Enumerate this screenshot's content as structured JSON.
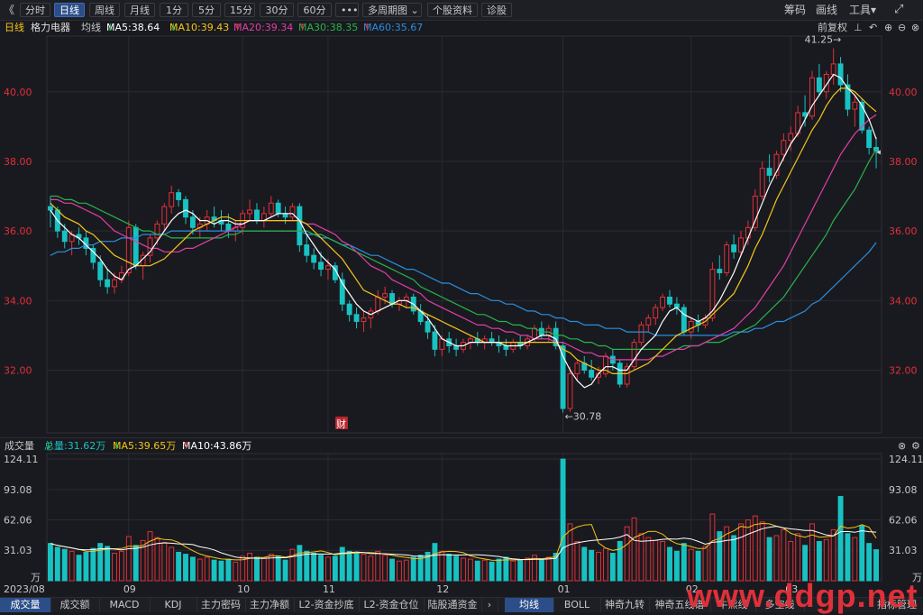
{
  "toolbar": {
    "back": "《",
    "periods": [
      "分时",
      "日线",
      "周线",
      "月线",
      "1分",
      "5分",
      "15分",
      "30分",
      "60分",
      "•••",
      "多周期图",
      "个股资料",
      "诊股"
    ],
    "multi_arrow": "⌄",
    "right_items": [
      "筹码",
      "画线",
      "工具"
    ],
    "tools_arrow": "▾",
    "fullscreen": "⤢"
  },
  "ma": {
    "period": "日线",
    "name": "格力电器",
    "line_label": "均线",
    "ma5": "MA5:38.64",
    "ma5_arrow": "↓",
    "ma10": "MA10:39.43",
    "ma10_arrow": "↓",
    "ma20": "MA20:39.34",
    "ma20_arrow": "↑",
    "ma30": "MA30:38.35",
    "ma30_arrow": "↑",
    "ma60": "MA60:35.67",
    "ma60_arrow": "↑",
    "adjust": "前复权",
    "colors": {
      "ma5": "#ffffff",
      "ma10": "#f5c518",
      "ma20": "#e03ea8",
      "ma30": "#28b34b",
      "ma60": "#2a8ee0"
    }
  },
  "vol": {
    "label": "成交量",
    "total": "总量:31.62万",
    "total_arrow": "↓",
    "ma5": "MA5:39.65万",
    "ma5_arrow": "↓",
    "ma10": "MA10:43.86万",
    "ma10_arrow": "↑"
  },
  "chart_labels": {
    "price_ticks": [
      "40.00",
      "38.00",
      "36.00",
      "34.00",
      "32.00"
    ],
    "vol_ticks": [
      "124.11",
      "93.08",
      "62.06",
      "31.03",
      "万"
    ],
    "x_ticks": [
      "2023/08",
      "09",
      "10",
      "11",
      "12",
      "01",
      "02",
      "03"
    ],
    "high_label": "41.25→",
    "low_label": "←30.78",
    "cai_marker": "财",
    "last_marker": "◂"
  },
  "bottom_tabs": [
    "成交量",
    "成交额",
    "MACD",
    "KDJ",
    "主力密码",
    "主力净额",
    "L2-资金抄底",
    "L2-资金仓位",
    "陆股通资金",
    "›",
    "均线",
    "BOLL",
    "神奇九转",
    "神奇五线谱",
    "牛熊线",
    "多空线",
    "指标管理"
  ],
  "watermark": "www.ddgp.net",
  "chart_data": {
    "type": "candlestick",
    "title": "格力电器 日线",
    "price_ylim": [
      30.2,
      41.6
    ],
    "volume_unit": "万",
    "volume_ylim": [
      0,
      124.11
    ],
    "candles": [
      [
        36.7,
        37.0,
        36.1,
        36.6,
        38
      ],
      [
        36.6,
        36.7,
        35.8,
        36.0,
        34
      ],
      [
        36.0,
        36.2,
        35.5,
        35.7,
        32
      ],
      [
        35.7,
        36.0,
        35.3,
        35.9,
        30
      ],
      [
        35.9,
        36.1,
        35.6,
        35.8,
        26
      ],
      [
        35.8,
        36.0,
        35.3,
        35.5,
        29
      ],
      [
        35.5,
        35.6,
        34.9,
        35.1,
        33
      ],
      [
        35.1,
        35.3,
        34.4,
        34.6,
        38
      ],
      [
        34.6,
        34.9,
        34.2,
        34.4,
        35
      ],
      [
        34.4,
        34.8,
        34.2,
        34.6,
        28
      ],
      [
        34.6,
        35.0,
        34.5,
        34.8,
        30
      ],
      [
        34.8,
        36.3,
        34.7,
        36.1,
        45
      ],
      [
        36.1,
        36.2,
        34.9,
        35.0,
        36
      ],
      [
        35.0,
        35.4,
        34.6,
        35.3,
        41
      ],
      [
        35.3,
        35.9,
        35.1,
        35.8,
        50
      ],
      [
        35.8,
        36.3,
        35.6,
        36.2,
        44
      ],
      [
        36.2,
        36.8,
        36.0,
        36.7,
        39
      ],
      [
        36.7,
        37.3,
        36.5,
        37.1,
        34
      ],
      [
        37.1,
        37.2,
        36.7,
        36.9,
        29
      ],
      [
        36.9,
        37.0,
        36.2,
        36.4,
        27
      ],
      [
        36.4,
        36.6,
        35.9,
        36.1,
        24
      ],
      [
        36.1,
        36.4,
        35.8,
        36.2,
        22
      ],
      [
        36.2,
        36.6,
        36.0,
        36.4,
        24
      ],
      [
        36.4,
        36.7,
        36.1,
        36.3,
        21
      ],
      [
        36.3,
        36.6,
        36.0,
        36.2,
        20
      ],
      [
        36.2,
        36.5,
        35.8,
        36.0,
        22
      ],
      [
        36.0,
        36.3,
        35.7,
        36.1,
        19
      ],
      [
        36.1,
        36.6,
        35.9,
        36.5,
        25
      ],
      [
        36.5,
        36.9,
        36.3,
        36.6,
        28
      ],
      [
        36.6,
        36.8,
        36.2,
        36.3,
        24
      ],
      [
        36.3,
        36.7,
        36.1,
        36.5,
        23
      ],
      [
        36.5,
        37.0,
        36.4,
        36.8,
        27
      ],
      [
        36.8,
        36.9,
        36.4,
        36.5,
        25
      ],
      [
        36.5,
        36.7,
        36.2,
        36.4,
        21
      ],
      [
        36.4,
        36.8,
        36.3,
        36.7,
        32
      ],
      [
        36.7,
        36.8,
        35.4,
        35.6,
        36
      ],
      [
        35.6,
        35.9,
        35.1,
        35.3,
        30
      ],
      [
        35.3,
        35.5,
        34.9,
        35.1,
        28
      ],
      [
        35.1,
        35.4,
        34.7,
        34.9,
        26
      ],
      [
        34.9,
        35.2,
        34.6,
        35.0,
        24
      ],
      [
        35.0,
        35.1,
        34.5,
        34.6,
        25
      ],
      [
        34.6,
        34.8,
        33.7,
        33.9,
        34
      ],
      [
        33.9,
        34.0,
        33.4,
        33.6,
        30
      ],
      [
        33.6,
        33.8,
        33.2,
        33.4,
        28
      ],
      [
        33.4,
        33.7,
        33.1,
        33.5,
        27
      ],
      [
        33.5,
        33.8,
        33.2,
        33.7,
        25
      ],
      [
        33.7,
        34.3,
        33.6,
        34.1,
        30
      ],
      [
        34.1,
        34.4,
        33.9,
        34.2,
        26
      ],
      [
        34.2,
        34.3,
        33.8,
        33.9,
        22
      ],
      [
        33.9,
        34.1,
        33.7,
        34.0,
        20
      ],
      [
        34.0,
        34.2,
        33.8,
        34.1,
        21
      ],
      [
        34.1,
        34.2,
        33.6,
        33.7,
        24
      ],
      [
        33.7,
        33.9,
        33.3,
        33.4,
        26
      ],
      [
        33.4,
        33.6,
        32.9,
        33.1,
        29
      ],
      [
        33.1,
        33.3,
        32.4,
        32.6,
        38
      ],
      [
        32.6,
        33.0,
        32.4,
        32.9,
        30
      ],
      [
        32.9,
        33.1,
        32.5,
        32.7,
        27
      ],
      [
        32.7,
        32.9,
        32.4,
        32.6,
        25
      ],
      [
        32.6,
        32.9,
        32.5,
        32.8,
        23
      ],
      [
        32.8,
        33.0,
        32.6,
        32.9,
        22
      ],
      [
        32.9,
        33.1,
        32.7,
        32.8,
        20
      ],
      [
        32.8,
        33.0,
        32.6,
        32.9,
        21
      ],
      [
        32.9,
        33.1,
        32.7,
        32.8,
        19
      ],
      [
        32.8,
        33.0,
        32.5,
        32.7,
        22
      ],
      [
        32.7,
        32.9,
        32.4,
        32.6,
        24
      ],
      [
        32.6,
        32.9,
        32.5,
        32.8,
        20
      ],
      [
        32.8,
        33.0,
        32.6,
        32.7,
        21
      ],
      [
        32.7,
        33.0,
        32.6,
        32.9,
        23
      ],
      [
        32.9,
        33.3,
        32.8,
        33.2,
        26
      ],
      [
        33.2,
        33.4,
        32.9,
        33.0,
        22
      ],
      [
        33.0,
        33.3,
        32.8,
        33.2,
        24
      ],
      [
        33.2,
        33.4,
        32.6,
        32.7,
        28
      ],
      [
        32.7,
        32.8,
        30.78,
        30.9,
        124
      ],
      [
        30.9,
        32.1,
        30.8,
        31.9,
        58
      ],
      [
        31.9,
        32.3,
        31.7,
        32.2,
        40
      ],
      [
        32.2,
        32.4,
        31.9,
        32.0,
        34
      ],
      [
        32.0,
        32.3,
        31.7,
        31.8,
        31
      ],
      [
        31.8,
        32.1,
        31.6,
        31.9,
        29
      ],
      [
        31.9,
        32.5,
        31.8,
        32.4,
        33
      ],
      [
        32.4,
        32.6,
        32.0,
        32.2,
        28
      ],
      [
        32.2,
        32.3,
        31.5,
        31.6,
        40
      ],
      [
        31.6,
        32.2,
        31.5,
        32.1,
        55
      ],
      [
        32.1,
        32.9,
        32.0,
        32.8,
        64
      ],
      [
        32.8,
        33.4,
        32.7,
        33.3,
        48
      ],
      [
        33.3,
        33.6,
        33.1,
        33.5,
        44
      ],
      [
        33.5,
        33.9,
        33.3,
        33.8,
        41
      ],
      [
        33.8,
        34.2,
        33.7,
        34.1,
        40
      ],
      [
        34.1,
        34.3,
        33.8,
        33.9,
        34
      ],
      [
        33.9,
        34.1,
        33.6,
        33.8,
        30
      ],
      [
        33.8,
        33.9,
        33.0,
        33.1,
        38
      ],
      [
        33.1,
        33.5,
        32.9,
        33.4,
        32
      ],
      [
        33.4,
        33.6,
        33.1,
        33.3,
        30
      ],
      [
        33.3,
        33.6,
        33.2,
        33.5,
        35
      ],
      [
        33.5,
        35.1,
        33.4,
        34.9,
        68
      ],
      [
        34.9,
        35.3,
        34.6,
        34.8,
        50
      ],
      [
        34.8,
        35.7,
        34.7,
        35.6,
        55
      ],
      [
        35.6,
        35.9,
        35.2,
        35.4,
        46
      ],
      [
        35.4,
        36.0,
        35.3,
        35.8,
        58
      ],
      [
        35.8,
        36.3,
        35.6,
        36.1,
        62
      ],
      [
        36.1,
        37.2,
        36.0,
        37.0,
        66
      ],
      [
        37.0,
        38.0,
        36.9,
        37.8,
        60
      ],
      [
        37.8,
        38.2,
        37.4,
        37.6,
        44
      ],
      [
        37.6,
        38.3,
        37.5,
        38.2,
        46
      ],
      [
        38.2,
        38.8,
        38.0,
        38.6,
        52
      ],
      [
        38.6,
        39.0,
        38.3,
        38.8,
        40
      ],
      [
        38.8,
        39.6,
        38.7,
        39.4,
        48
      ],
      [
        39.4,
        39.9,
        39.0,
        39.3,
        36
      ],
      [
        39.3,
        40.6,
        39.2,
        40.4,
        58
      ],
      [
        40.4,
        40.8,
        39.9,
        40.0,
        40
      ],
      [
        40.0,
        40.6,
        39.8,
        40.5,
        42
      ],
      [
        40.5,
        41.25,
        40.2,
        40.8,
        52
      ],
      [
        40.8,
        41.0,
        40.0,
        40.2,
        86
      ],
      [
        40.2,
        40.5,
        39.3,
        39.5,
        48
      ],
      [
        39.5,
        39.9,
        39.0,
        39.7,
        44
      ],
      [
        39.7,
        39.8,
        38.8,
        38.9,
        56
      ],
      [
        38.9,
        39.0,
        38.2,
        38.4,
        38
      ],
      [
        38.4,
        38.7,
        37.8,
        38.3,
        31.62
      ]
    ],
    "ma5": [
      36.6,
      36.3,
      36.1,
      35.9,
      35.8,
      35.6,
      35.4,
      35.2,
      34.9,
      34.7,
      34.6,
      34.9,
      35.0,
      35.2,
      35.4,
      35.7,
      36.0,
      36.3,
      36.5,
      36.6,
      36.5,
      36.3,
      36.3,
      36.2,
      36.3,
      36.3,
      36.2,
      36.2,
      36.3,
      36.3,
      36.3,
      36.4,
      36.5,
      36.5,
      36.5,
      36.3,
      35.9,
      35.6,
      35.3,
      35.1,
      34.9,
      34.5,
      34.2,
      33.9,
      33.7,
      33.6,
      33.7,
      33.8,
      33.9,
      34.0,
      34.0,
      33.9,
      33.7,
      33.5,
      33.2,
      32.9,
      32.8,
      32.7,
      32.7,
      32.8,
      32.8,
      32.8,
      32.8,
      32.8,
      32.7,
      32.7,
      32.7,
      32.8,
      32.9,
      33.0,
      33.0,
      32.9,
      32.4,
      32.0,
      31.7,
      31.5,
      31.6,
      31.9,
      32.1,
      32.1,
      32.0,
      32.0,
      32.3,
      32.6,
      32.8,
      33.0,
      33.4,
      33.7,
      33.8,
      33.6,
      33.5,
      33.4,
      33.5,
      33.7,
      34.0,
      34.4,
      34.8,
      35.3,
      35.8,
      36.3,
      36.8,
      37.3,
      37.7,
      38.1,
      38.5,
      38.8,
      39.2,
      39.6,
      39.9,
      40.2,
      40.5,
      40.4,
      40.1,
      39.9,
      39.6,
      39.2,
      38.64
    ],
    "ma10": [
      36.8,
      36.6,
      36.4,
      36.3,
      36.2,
      36.0,
      35.9,
      35.7,
      35.5,
      35.3,
      35.2,
      35.1,
      35.0,
      35.0,
      35.0,
      35.1,
      35.2,
      35.4,
      35.6,
      35.8,
      36.0,
      36.1,
      36.2,
      36.3,
      36.4,
      36.4,
      36.3,
      36.3,
      36.3,
      36.3,
      36.3,
      36.3,
      36.3,
      36.3,
      36.3,
      36.3,
      36.2,
      36.0,
      35.8,
      35.6,
      35.4,
      35.2,
      34.9,
      34.6,
      34.3,
      34.2,
      34.1,
      34.0,
      33.9,
      33.9,
      33.8,
      33.8,
      33.7,
      33.6,
      33.5,
      33.4,
      33.3,
      33.2,
      33.1,
      33.0,
      32.9,
      32.8,
      32.8,
      32.8,
      32.8,
      32.8,
      32.8,
      32.8,
      32.8,
      32.8,
      32.8,
      32.8,
      32.6,
      32.5,
      32.3,
      32.2,
      32.1,
      32.0,
      32.0,
      31.9,
      31.9,
      31.9,
      32.0,
      32.1,
      32.2,
      32.4,
      32.6,
      32.8,
      33.0,
      33.1,
      33.2,
      33.3,
      33.4,
      33.6,
      33.8,
      34.0,
      34.2,
      34.6,
      35.0,
      35.5,
      35.9,
      36.4,
      36.9,
      37.3,
      37.7,
      38.1,
      38.5,
      38.9,
      39.2,
      39.6,
      39.9,
      40.1,
      40.1,
      40.0,
      39.8,
      39.6,
      39.43
    ],
    "ma20": [
      36.9,
      36.9,
      36.8,
      36.8,
      36.7,
      36.6,
      36.5,
      36.4,
      36.2,
      36.0,
      35.9,
      35.8,
      35.7,
      35.6,
      35.5,
      35.5,
      35.4,
      35.4,
      35.4,
      35.5,
      35.5,
      35.6,
      35.7,
      35.8,
      35.9,
      36.0,
      36.1,
      36.2,
      36.3,
      36.3,
      36.3,
      36.3,
      36.3,
      36.3,
      36.3,
      36.3,
      36.2,
      36.2,
      36.1,
      36.0,
      35.9,
      35.7,
      35.6,
      35.4,
      35.2,
      35.0,
      34.9,
      34.8,
      34.6,
      34.5,
      34.4,
      34.3,
      34.2,
      34.0,
      33.9,
      33.8,
      33.7,
      33.6,
      33.5,
      33.4,
      33.3,
      33.3,
      33.2,
      33.2,
      33.1,
      33.1,
      33.0,
      33.0,
      32.9,
      32.9,
      32.9,
      32.8,
      32.8,
      32.7,
      32.6,
      32.5,
      32.5,
      32.4,
      32.4,
      32.3,
      32.3,
      32.3,
      32.3,
      32.3,
      32.3,
      32.4,
      32.4,
      32.5,
      32.6,
      32.6,
      32.7,
      32.7,
      32.8,
      32.9,
      33.0,
      33.1,
      33.2,
      33.4,
      33.6,
      33.8,
      34.1,
      34.4,
      34.7,
      35.0,
      35.4,
      35.8,
      36.2,
      36.6,
      37.0,
      37.4,
      37.8,
      38.2,
      38.5,
      38.8,
      39.0,
      39.2,
      39.34
    ],
    "ma30": [
      37.0,
      37.0,
      36.9,
      36.9,
      36.8,
      36.8,
      36.7,
      36.6,
      36.5,
      36.4,
      36.3,
      36.2,
      36.1,
      36.0,
      36.0,
      35.9,
      35.9,
      35.8,
      35.8,
      35.8,
      35.8,
      35.8,
      35.8,
      35.8,
      35.8,
      35.9,
      35.9,
      36.0,
      36.0,
      36.0,
      36.0,
      36.0,
      36.0,
      36.0,
      36.0,
      36.0,
      36.0,
      35.9,
      35.9,
      35.8,
      35.7,
      35.6,
      35.5,
      35.4,
      35.3,
      35.2,
      35.1,
      35.0,
      34.9,
      34.8,
      34.7,
      34.6,
      34.4,
      34.3,
      34.2,
      34.1,
      34.0,
      33.9,
      33.8,
      33.7,
      33.6,
      33.6,
      33.5,
      33.4,
      33.4,
      33.3,
      33.3,
      33.2,
      33.2,
      33.1,
      33.1,
      33.0,
      33.0,
      32.9,
      32.9,
      32.8,
      32.8,
      32.7,
      32.7,
      32.6,
      32.6,
      32.6,
      32.6,
      32.6,
      32.6,
      32.6,
      32.6,
      32.6,
      32.6,
      32.7,
      32.7,
      32.7,
      32.8,
      32.8,
      32.8,
      32.9,
      33.0,
      33.1,
      33.2,
      33.3,
      33.5,
      33.7,
      33.9,
      34.1,
      34.4,
      34.7,
      35.0,
      35.3,
      35.6,
      35.9,
      36.3,
      36.6,
      36.9,
      37.2,
      37.6,
      38.0,
      38.35
    ],
    "ma60": [
      35.3,
      35.4,
      35.4,
      35.5,
      35.5,
      35.6,
      35.6,
      35.7,
      35.7,
      35.7,
      35.8,
      35.8,
      35.8,
      35.9,
      35.9,
      35.9,
      35.9,
      36.0,
      36.0,
      36.0,
      36.0,
      36.0,
      36.0,
      36.0,
      36.0,
      36.0,
      36.0,
      36.0,
      36.0,
      36.0,
      36.0,
      36.0,
      36.0,
      36.0,
      36.0,
      36.0,
      35.9,
      35.9,
      35.8,
      35.8,
      35.7,
      35.6,
      35.6,
      35.5,
      35.4,
      35.3,
      35.3,
      35.2,
      35.1,
      35.0,
      34.9,
      34.9,
      34.8,
      34.7,
      34.6,
      34.5,
      34.5,
      34.4,
      34.3,
      34.2,
      34.2,
      34.1,
      34.0,
      34.0,
      33.9,
      33.9,
      33.8,
      33.7,
      33.7,
      33.6,
      33.6,
      33.5,
      33.5,
      33.4,
      33.4,
      33.3,
      33.3,
      33.3,
      33.2,
      33.2,
      33.2,
      33.1,
      33.1,
      33.1,
      33.1,
      33.0,
      33.0,
      33.0,
      33.0,
      33.0,
      33.0,
      33.0,
      33.0,
      33.0,
      33.0,
      33.0,
      33.1,
      33.1,
      33.1,
      33.2,
      33.2,
      33.3,
      33.4,
      33.4,
      33.5,
      33.6,
      33.7,
      33.9,
      34.0,
      34.2,
      34.4,
      34.6,
      34.8,
      35.0,
      35.2,
      35.4,
      35.67
    ]
  }
}
